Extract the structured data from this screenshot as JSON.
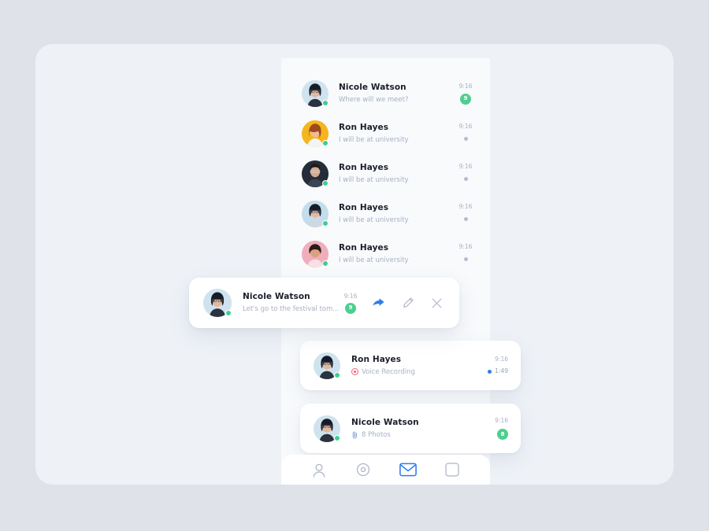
{
  "theme": {
    "page_background": "#dfe2e8",
    "panel_background": "#eef2f7",
    "column_background": "#f8fafc",
    "card_background": "#ffffff",
    "name_color": "#1b1f2b",
    "muted_color": "#a8b0c4",
    "badge_green": "#4ecf8f",
    "accent_blue": "#2e7de9",
    "record_red": "#f4607a",
    "presence_green": "#3ecf8e"
  },
  "conversations": [
    {
      "name": "Nicole Watson",
      "preview": "Where will we meet?",
      "time": "9:16",
      "badge": "9",
      "has_badge": true,
      "avatar_bg": "#cfe3ef",
      "avatar_kind": "woman-dark-hair",
      "online": true
    },
    {
      "name": "Ron Hayes",
      "preview": "I will be at university",
      "time": "9:16",
      "badge": "",
      "has_badge": false,
      "avatar_bg": "#f5b51e",
      "avatar_kind": "woman-red-hair",
      "online": true
    },
    {
      "name": "Ron Hayes",
      "preview": "I will be at university",
      "time": "9:16",
      "badge": "",
      "has_badge": false,
      "avatar_bg": "#252d3b",
      "avatar_kind": "man-glasses",
      "online": true
    },
    {
      "name": "Ron Hayes",
      "preview": "I will be at university",
      "time": "9:16",
      "badge": "",
      "has_badge": false,
      "avatar_bg": "#c3ddec",
      "avatar_kind": "woman-dark-hair",
      "online": true
    },
    {
      "name": "Ron Hayes",
      "preview": "I will be at university",
      "time": "9:16",
      "badge": "",
      "has_badge": false,
      "avatar_bg": "#f0aebc",
      "avatar_kind": "woman-smiling",
      "online": true
    }
  ],
  "highlight_card": {
    "name": "Nicole Watson",
    "preview": "Let's go to the festival tom...",
    "time": "9:16",
    "badge": "9",
    "avatar_bg": "#cfe3ef",
    "online": true,
    "actions": [
      {
        "icon": "forward-arrow-icon",
        "label": "Forward",
        "color": "#2e7de9"
      },
      {
        "icon": "pencil-edit-icon",
        "label": "Edit",
        "color": "#aab2c6"
      },
      {
        "icon": "close-x-icon",
        "label": "Close",
        "color": "#b4bbcd"
      }
    ]
  },
  "voice_card": {
    "name": "Ron Hayes",
    "preview": "Voice Recording",
    "preview_icon": "record-circle-icon",
    "time": "9:16",
    "duration": "1:49",
    "avatar_bg": "#cfe3ef",
    "online": true
  },
  "photos_card": {
    "name": "Nicole Watson",
    "preview": "8 Photos",
    "preview_icon": "paperclip-icon",
    "time": "9:16",
    "badge": "8",
    "avatar_bg": "#cfe3ef",
    "online": true
  },
  "bottom_nav": {
    "items": [
      {
        "icon": "profile-circle-icon",
        "label": "Profile",
        "active": false
      },
      {
        "icon": "camera-target-icon",
        "label": "Discover",
        "active": false
      },
      {
        "icon": "mail-envelope-icon",
        "label": "Messages",
        "active": true
      },
      {
        "icon": "bookmark-square-icon",
        "label": "Saved",
        "active": false
      }
    ]
  }
}
